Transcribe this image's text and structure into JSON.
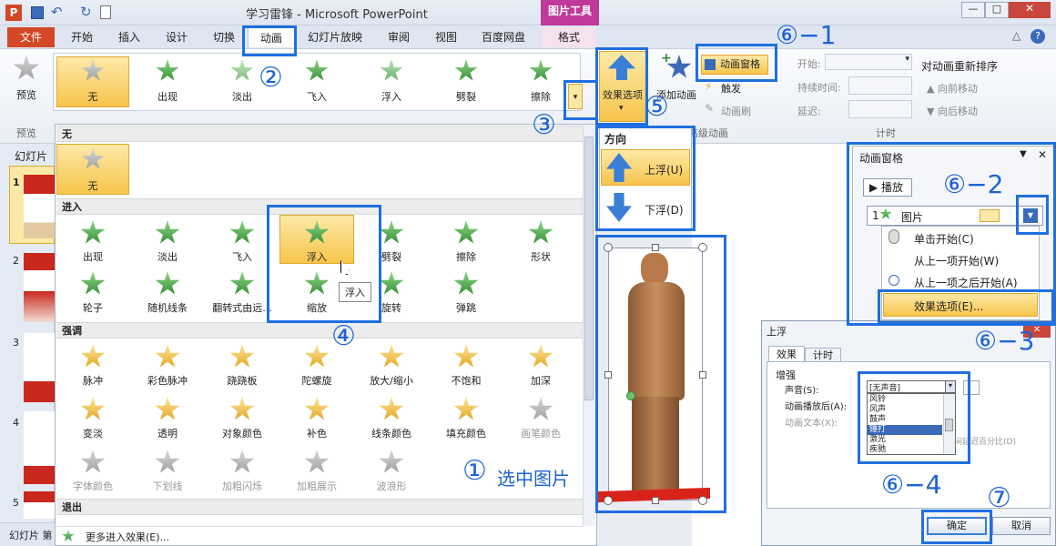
{
  "window": {
    "title": "学习雷锋 - Microsoft PowerPoint",
    "tools": "图片工具"
  },
  "tabs": {
    "file": "文件",
    "home": "开始",
    "insert": "插入",
    "design": "设计",
    "transitions": "切换",
    "animations": "动画",
    "slideshow": "幻灯片放映",
    "review": "审阅",
    "view": "视图",
    "netdisk": "百度网盘",
    "format": "格式"
  },
  "ribbon": {
    "preview": "预览",
    "preview_group": "预览",
    "gallery": [
      "无",
      "出现",
      "淡出",
      "飞入",
      "浮入",
      "劈裂",
      "擦除"
    ],
    "effect_options": "效果选项",
    "add_animation": "添加动画",
    "animation_pane": "动画窗格",
    "trigger": "触发",
    "painter": "动画刷",
    "adv_group": "高级动画",
    "start_label": "开始:",
    "duration_label": "持续时间:",
    "delay_label": "延迟:",
    "timing_group": "计时",
    "reorder": "对动画重新排序",
    "move_earlier": "向前移动",
    "move_later": "向后移动"
  },
  "slides_panel": {
    "title": "幻灯片",
    "numbers": [
      "1",
      "2",
      "3",
      "4",
      "5"
    ],
    "status": "幻灯片 第"
  },
  "gallery": {
    "none_header": "无",
    "none_label": "无",
    "enter_header": "进入",
    "enter": [
      "出现",
      "淡出",
      "飞入",
      "浮入",
      "劈裂",
      "擦除",
      "形状",
      "轮子",
      "随机线条",
      "翻转式由远...",
      "缩放",
      "旋转",
      "弹跳"
    ],
    "tooltip": "浮入",
    "emphasis_header": "强调",
    "emphasis": [
      "脉冲",
      "彩色脉冲",
      "跷跷板",
      "陀螺旋",
      "放大/缩小",
      "不饱和",
      "加深",
      "变淡",
      "透明",
      "对象颜色",
      "补色",
      "线条颜色",
      "填充颜色",
      "画笔颜色",
      "字体颜色",
      "下划线",
      "加粗闪烁",
      "加粗展示",
      "波浪形"
    ],
    "exit_header": "退出",
    "more": "更多进入效果(E)..."
  },
  "direction": {
    "header": "方向",
    "up": "上浮(U)",
    "down": "下浮(D)"
  },
  "anim_pane": {
    "title": "动画窗格",
    "play": "播放",
    "item_num": "1",
    "item_label": "图片",
    "menu": [
      "单击开始(C)",
      "从上一项开始(W)",
      "从上一项之后开始(A)",
      "效果选项(E)..."
    ]
  },
  "dialog": {
    "title": "上浮",
    "tab_effect": "效果",
    "tab_timing": "计时",
    "section": "增强",
    "sound_label": "声音(S):",
    "sound_value": "[无声音]",
    "after_label": "动画播放后(A):",
    "text_label": "动画文本(X):",
    "sound_options": [
      "风铃",
      "风声",
      "鼓声",
      "锤打",
      "激光",
      "疾驰"
    ],
    "percent": "间延迟百分比(D)",
    "ok": "确定",
    "cancel": "取消"
  },
  "annotations": {
    "a1": "①",
    "a1_text": "选中图片",
    "a2": "②",
    "a3": "③",
    "a4": "④",
    "a5": "⑤",
    "a61": "⑥−1",
    "a62": "⑥−2",
    "a63": "⑥−3",
    "a64": "⑥−4",
    "a7": "⑦"
  },
  "colors": {
    "accent": "#1f6fe0",
    "file_tab": "#d24726",
    "tools": "#c0399b"
  }
}
